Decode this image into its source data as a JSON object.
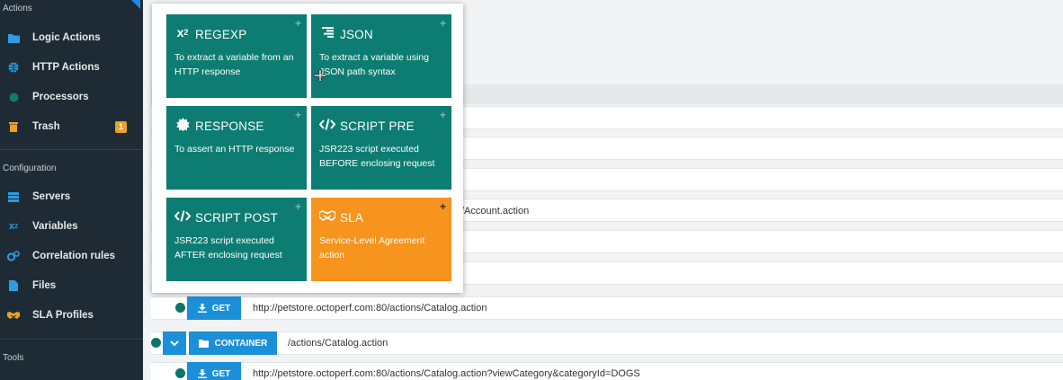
{
  "sidebar": {
    "sections": {
      "actions": "Actions",
      "configuration": "Configuration",
      "tools": "Tools"
    },
    "items": [
      {
        "label": "Logic Actions",
        "icon": "folder-icon",
        "color": "#2f9be0"
      },
      {
        "label": "HTTP Actions",
        "icon": "globe-icon",
        "color": "#2f9be0"
      },
      {
        "label": "Processors",
        "icon": "circle-icon",
        "color": "#0d7c72"
      },
      {
        "label": "Trash",
        "icon": "trash-icon",
        "color": "#f0a020",
        "badge": "1"
      },
      {
        "label": "Servers",
        "icon": "server-icon",
        "color": "#2f9be0"
      },
      {
        "label": "Variables",
        "icon": "superscript-icon",
        "color": "#2f9be0"
      },
      {
        "label": "Correlation rules",
        "icon": "cogs-icon",
        "color": "#2f9be0"
      },
      {
        "label": "Files",
        "icon": "file-icon",
        "color": "#2f9be0"
      },
      {
        "label": "SLA Profiles",
        "icon": "handshake-icon",
        "color": "#f0a020"
      }
    ]
  },
  "popup": {
    "tiles": [
      {
        "title": "REGEXP",
        "desc": "To extract a variable from an HTTP response",
        "icon": "superscript-icon",
        "plus": "+"
      },
      {
        "title": "JSON",
        "desc": "To extract a variable using JSON path syntax",
        "icon": "align-right-icon",
        "plus": "+"
      },
      {
        "title": "RESPONSE",
        "desc": "To assert an HTTP response",
        "icon": "certificate-icon",
        "plus": "+"
      },
      {
        "title": "SCRIPT PRE",
        "desc": "JSR223 script executed BEFORE enclosing request",
        "icon": "code-icon",
        "plus": "+"
      },
      {
        "title": "SCRIPT POST",
        "desc": "JSR223 script executed AFTER enclosing request",
        "icon": "code-icon",
        "plus": "+"
      },
      {
        "title": "SLA",
        "desc": "Service-Level Agreement action",
        "icon": "handshake-icon",
        "plus": "+"
      }
    ]
  },
  "main": {
    "partial_url": "/Account.action",
    "get_label": "GET",
    "container_label": "CONTAINER",
    "rows": [
      {
        "url": "http://petstore.octoperf.com:80/actions/Catalog.action"
      },
      {
        "container_path": "/actions/Catalog.action"
      },
      {
        "url": "http://petstore.octoperf.com:80/actions/Catalog.action?viewCategory&categoryId=DOGS"
      }
    ]
  },
  "colors": {
    "sidebar_bg": "#1f2b34",
    "tile_teal": "#0d7c72",
    "tile_orange": "#f7941d",
    "button_blue": "#1b8fd8",
    "accent_dot": "#0d7568"
  }
}
